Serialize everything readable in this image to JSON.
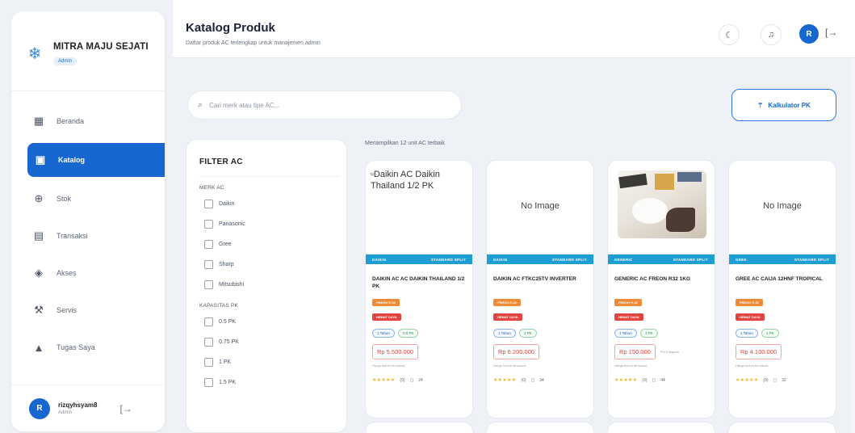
{
  "brand": {
    "name": "MITRA MAJU SEJATI",
    "badge": "Admin",
    "logo_icon": "snowflake-icon"
  },
  "sidebar": {
    "items": [
      {
        "label": "Beranda",
        "icon": "grid-icon",
        "glyph": "▦",
        "active": false
      },
      {
        "label": "Katalog",
        "icon": "book-icon",
        "glyph": "▣",
        "active": true
      },
      {
        "label": "Stok",
        "icon": "package-icon",
        "glyph": "⊕",
        "active": false
      },
      {
        "label": "Transaksi",
        "icon": "receipt-icon",
        "glyph": "▤",
        "active": false
      },
      {
        "label": "Akses",
        "icon": "shield-icon",
        "glyph": "◈",
        "active": false
      },
      {
        "label": "Servis",
        "icon": "wrench-icon",
        "glyph": "⚒",
        "active": false
      },
      {
        "label": "Tugas Saya",
        "icon": "clipboard-icon",
        "glyph": "▲",
        "active": false
      }
    ],
    "user": {
      "initial": "R",
      "name": "rizqyhsyam8",
      "role": "Admin"
    }
  },
  "header": {
    "title": "Katalog Produk",
    "subtitle": "Daftar produk AC terlengkap untuk manajemen admin",
    "avatar_initial": "R"
  },
  "search": {
    "placeholder": "Cari merk atau tipe AC..."
  },
  "calc_button": {
    "label": "Kalkulator PK",
    "icon": "wand-icon"
  },
  "filter": {
    "title": "FILTER AC",
    "merk_title": "MERK AC",
    "merk": [
      "Daikin",
      "Panasonic",
      "Gree",
      "Sharp",
      "Mitsubishi"
    ],
    "kapasitas_title": "KAPASITAS PK",
    "kapasitas": [
      "0.5 PK",
      "0.75 PK",
      "1 PK",
      "1.5 PK"
    ]
  },
  "results": {
    "count_text": "Menampilkan 12 unit AC terbaik"
  },
  "products": [
    {
      "image": "alt",
      "alt": "Daikin AC Daikin Thailand 1/2 PK",
      "brand_tag": "DAIKIN",
      "type_tag": "STANDARD SPLIT",
      "title": "DAIKIN AC AC DAIKIN THAILAND 1/2 PK",
      "pill1": "FREON R-32",
      "pill2": "HEMAT DAYA",
      "chip1": "1 Tahun",
      "chip2": "0.5 PK",
      "price": "Rp 5.500.000",
      "price_note": "",
      "price_sub": "Harga belum termasuk",
      "rating": "(0)",
      "sold": "24"
    },
    {
      "image": "none",
      "alt": "No Image",
      "brand_tag": "DAIKIN",
      "type_tag": "STANDARD SPLIT",
      "title": "DAIKIN AC FTKC25TV INVERTER",
      "pill1": "FREON R-32",
      "pill2": "HEMAT DAYA",
      "chip1": "1 Tahun",
      "chip2": "1 PK",
      "price": "Rp 6.200.000",
      "price_note": "",
      "price_sub": "Harga belum termasuk",
      "rating": "(0)",
      "sold": "34"
    },
    {
      "image": "photo",
      "alt": "",
      "brand_tag": "GENERIC",
      "type_tag": "STANDARD SPLIT",
      "title": "GENERIC AC FREON R32 1KG",
      "pill1": "FREON R-32",
      "pill2": "HEMAT DAYA",
      "chip1": "1 Tahun",
      "chip2": "1 PK",
      "price": "Rp 150.000",
      "price_note": "Per Kilogram",
      "price_sub": "Harga belum termasuk",
      "rating": "(0)",
      "sold": "44"
    },
    {
      "image": "none",
      "alt": "No Image",
      "brand_tag": "GREE",
      "type_tag": "STANDARD SPLIT",
      "title": "GREE AC CAIJA 12HNF TROPICAL",
      "pill1": "FREON R-32",
      "pill2": "HEMAT DAYA",
      "chip1": "1 Tahun",
      "chip2": "1 PK",
      "price": "Rp 4.100.000",
      "price_note": "",
      "price_sub": "Harga belum termasuk",
      "rating": "(0)",
      "sold": "32"
    }
  ],
  "colors": {
    "accent": "#1866cf",
    "tagbar": "#1e9ed3",
    "pill_orange": "#f08a34",
    "pill_red": "#e2443f"
  }
}
